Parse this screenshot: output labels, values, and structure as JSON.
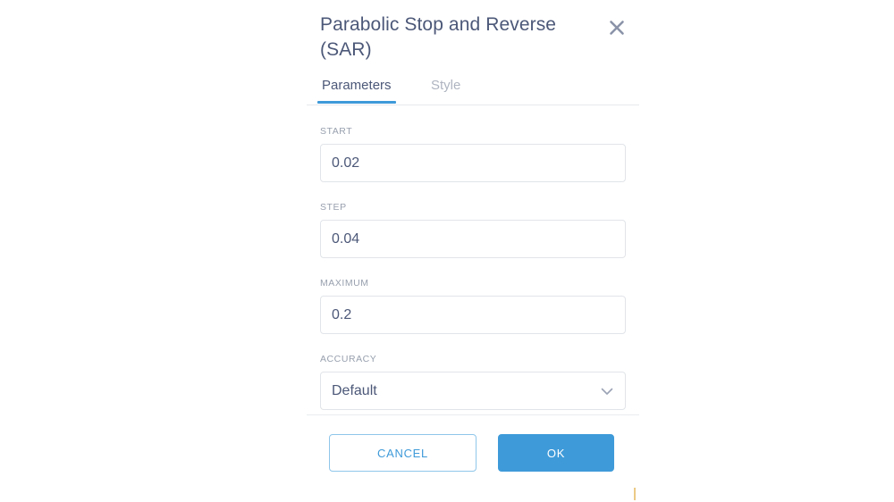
{
  "dialog": {
    "title": "Parabolic Stop and Reverse (SAR)",
    "close_icon": "close-icon",
    "tabs": [
      {
        "label": "Parameters",
        "active": true
      },
      {
        "label": "Style",
        "active": false
      }
    ],
    "fields": [
      {
        "label": "START",
        "value": "0.02",
        "type": "text",
        "name": "start"
      },
      {
        "label": "STEP",
        "value": "0.04",
        "type": "text",
        "name": "step"
      },
      {
        "label": "MAXIMUM",
        "value": "0.2",
        "type": "text",
        "name": "maximum"
      },
      {
        "label": "ACCURACY",
        "value": "Default",
        "type": "select",
        "name": "accuracy",
        "icon": "chevron-down-icon"
      }
    ],
    "footer": {
      "cancel_label": "CANCEL",
      "ok_label": "OK"
    }
  },
  "colors": {
    "accent_blue": "#3e9ad9",
    "cancel_border": "#8fc6ea",
    "title_text": "#4c5878",
    "label_text": "#98a0ae",
    "inactive_tab": "#aeb4c0",
    "input_border": "#e1e4e9",
    "divider": "#e6e9ed",
    "close_icon": "#8a93a8",
    "chevron": "#9aa3b5",
    "page_background": "#ffffff"
  }
}
